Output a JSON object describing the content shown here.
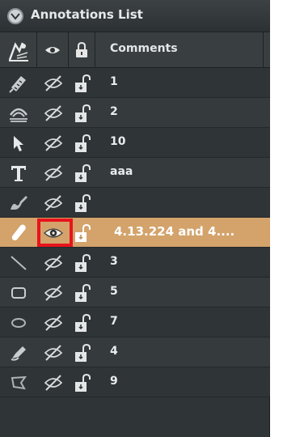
{
  "panel": {
    "title": "Annotations List"
  },
  "header": {
    "comments_label": "Comments"
  },
  "rows": [
    {
      "tool": "ruler-icon",
      "comment": "1"
    },
    {
      "tool": "arc-icon",
      "comment": "2"
    },
    {
      "tool": "arrow-icon",
      "comment": "10"
    },
    {
      "tool": "text-icon",
      "comment": "aaa"
    },
    {
      "tool": "freehand-icon",
      "comment": ""
    },
    {
      "tool": "highlight-marker-icon",
      "comment": "4.13.224 and 4....",
      "selected": true,
      "visible": true
    },
    {
      "tool": "line-icon",
      "comment": "3"
    },
    {
      "tool": "rectangle-icon",
      "comment": "5"
    },
    {
      "tool": "ellipse-icon",
      "comment": "7"
    },
    {
      "tool": "pencil-icon",
      "comment": "4"
    },
    {
      "tool": "polygon-icon",
      "comment": "9"
    }
  ],
  "colors": {
    "selected_row": "#d3a36b",
    "highlight_box": "#e8141d"
  }
}
